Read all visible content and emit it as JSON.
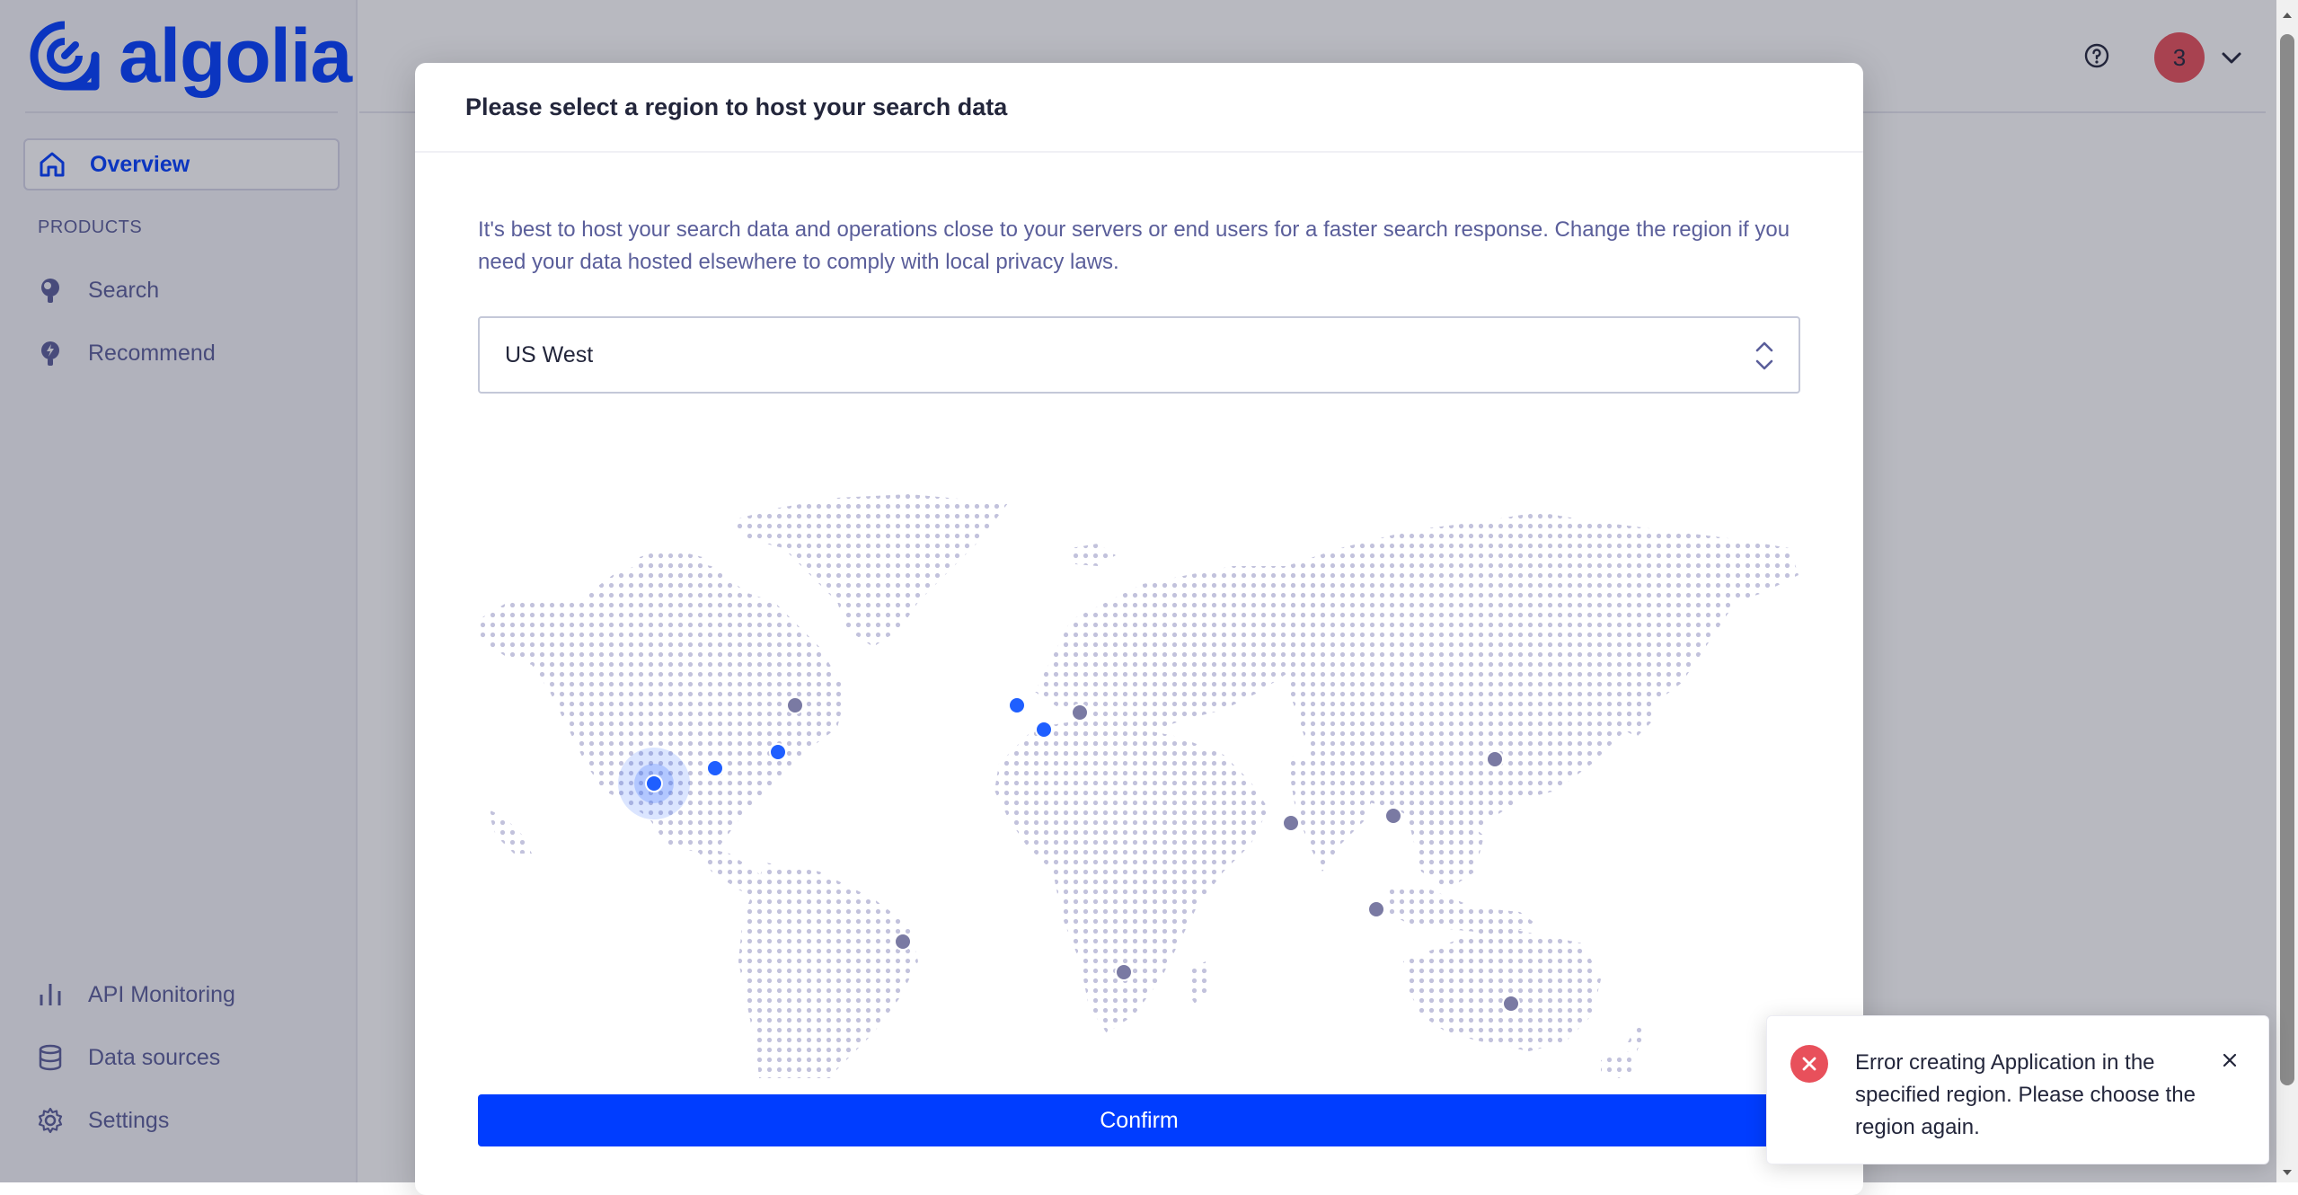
{
  "app": {
    "logo_text": "algolia",
    "nav": {
      "overview": "Overview",
      "products_label": "PRODUCTS",
      "search": "Search",
      "recommend": "Recommend",
      "api_monitoring": "API Monitoring",
      "data_sources": "Data sources",
      "settings": "Settings"
    },
    "header": {
      "help_icon": "question-circle-icon",
      "avatar_initial": "3",
      "avatar_color": "#e8505b"
    }
  },
  "modal": {
    "title": "Please select a region to host your search data",
    "description": "It's best to host your search data and operations close to your servers or end users for a faster search response. Change the region if you need your data hosted elsewhere to comply with local privacy laws.",
    "region_select": {
      "value": "US West"
    },
    "confirm_label": "Confirm",
    "map": {
      "available_color": "#1f5fff",
      "unavailable_color": "#7a7aa3",
      "selected_region": "US West"
    }
  },
  "toast": {
    "message": "Error creating Application in the specified region. Please choose the region again.",
    "status_color": "#e8505b"
  },
  "colors": {
    "brand": "#003dff",
    "text_primary": "#23263b",
    "text_secondary": "#5a5e9a"
  }
}
